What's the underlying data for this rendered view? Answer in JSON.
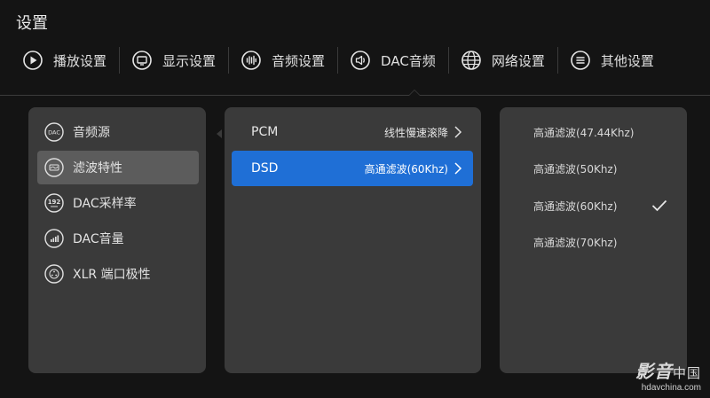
{
  "title": "设置",
  "tabs": [
    {
      "icon": "play-circle-icon",
      "label": "播放设置"
    },
    {
      "icon": "monitor-icon",
      "label": "显示设置"
    },
    {
      "icon": "audio-wave-icon",
      "label": "音频设置"
    },
    {
      "icon": "speaker-icon",
      "label": "DAC音频"
    },
    {
      "icon": "globe-icon",
      "label": "网络设置"
    },
    {
      "icon": "menu-circle-icon",
      "label": "其他设置"
    }
  ],
  "active_tab_index": 3,
  "left_menu": [
    {
      "icon": "dac-badge-icon",
      "icon_text": "DAC",
      "label": "音频源"
    },
    {
      "icon": "filter-icon",
      "label": "滤波特性"
    },
    {
      "icon": "sample-rate-icon",
      "icon_text": "192",
      "label": "DAC采样率"
    },
    {
      "icon": "volume-level-icon",
      "label": "DAC音量"
    },
    {
      "icon": "xlr-connector-icon",
      "label": "XLR 端口极性"
    }
  ],
  "selected_left_index": 1,
  "middle_list": [
    {
      "label": "PCM",
      "value": "线性慢速滚降"
    },
    {
      "label": "DSD",
      "value": "高通滤波(60Khz)"
    }
  ],
  "selected_middle_index": 1,
  "right_options": [
    {
      "label": "高通滤波(47.44Khz)"
    },
    {
      "label": "高通滤波(50Khz)"
    },
    {
      "label": "高通滤波(60Khz)"
    },
    {
      "label": "高通滤波(70Khz)"
    }
  ],
  "checked_right_index": 2,
  "watermark": {
    "big": "影音",
    "suffix": "中国",
    "site": "hdavchina.com"
  },
  "colors": {
    "accent": "#1f6fd6",
    "background": "#141414",
    "panel": "#3a3a3a",
    "selected": "#5c5c5c"
  }
}
